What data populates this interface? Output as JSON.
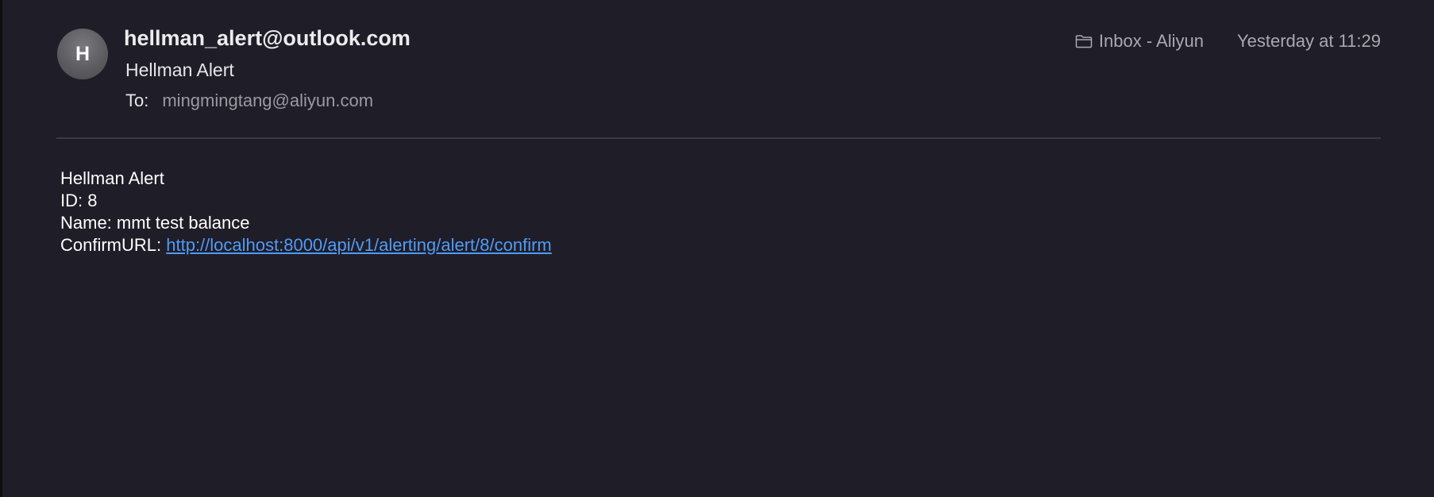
{
  "header": {
    "avatar_initial": "H",
    "sender_email": "hellman_alert@outlook.com",
    "sender_name": "Hellman Alert",
    "to_label": "To:",
    "to_value": "mingmingtang@aliyun.com",
    "mailbox": "Inbox - Aliyun",
    "mailbox_icon": "folder-icon",
    "timestamp": "Yesterday at 11:29"
  },
  "body": {
    "line1": "Hellman Alert",
    "line2": "ID: 8",
    "line3": "Name: mmt test balance",
    "confirm_label": "ConfirmURL: ",
    "confirm_url": "http://localhost:8000/api/v1/alerting/alert/8/confirm"
  },
  "colors": {
    "background": "#1f1d27",
    "link": "#4f9bf7",
    "secondary_text": "#a9a8b0"
  }
}
